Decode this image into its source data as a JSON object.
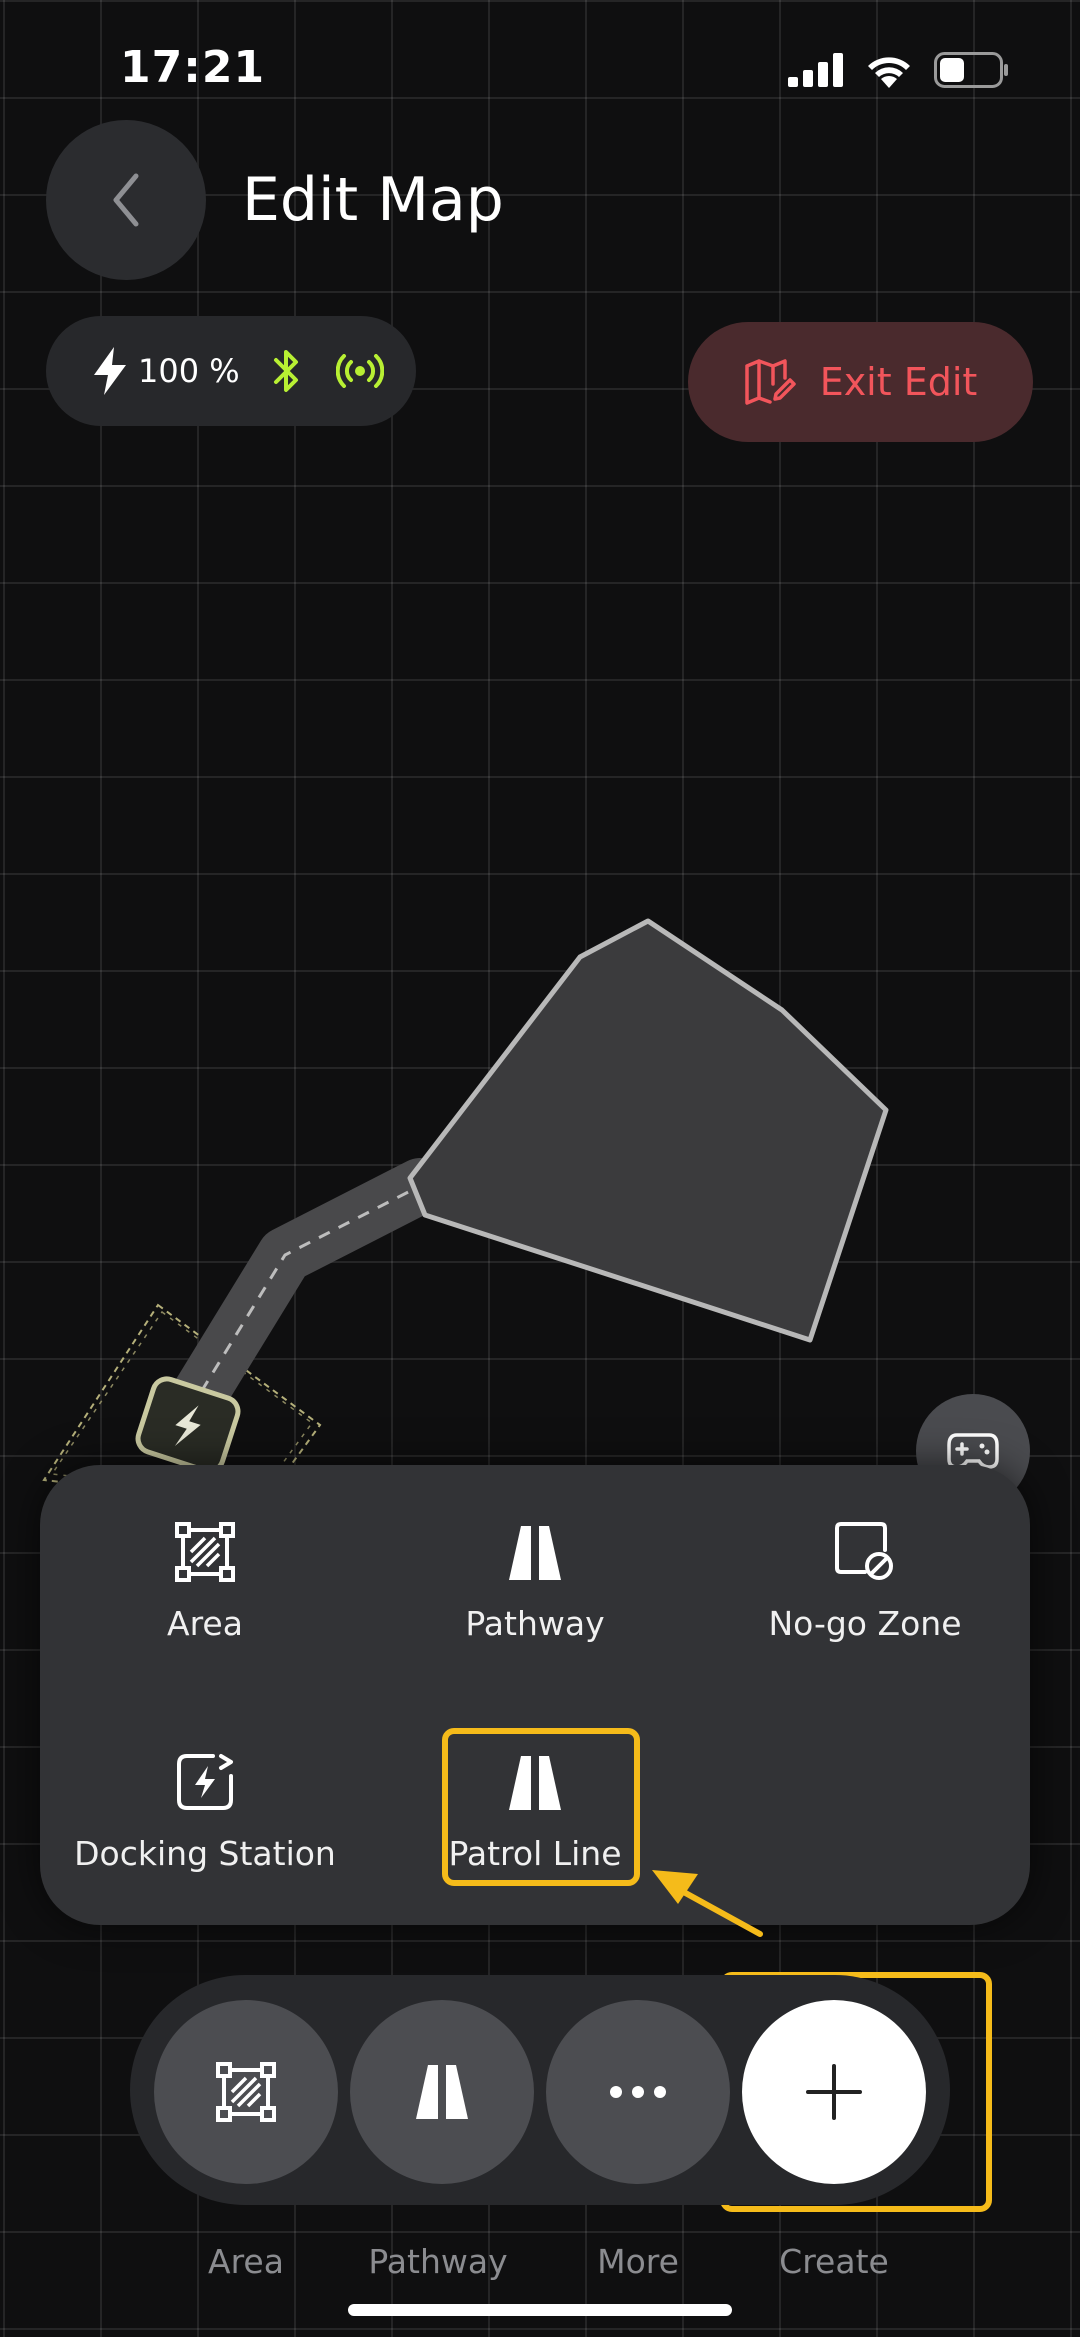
{
  "status_bar": {
    "time": "17:21"
  },
  "header": {
    "title": "Edit Map",
    "back_icon": "chevron-left-icon"
  },
  "robot_status": {
    "battery": "100 %",
    "bluetooth_icon": "bluetooth-icon",
    "signal_icon": "radio-signal-icon",
    "accent_color": "#b8f033"
  },
  "exit_edit": {
    "label": "Exit Edit",
    "icon": "map-edit-icon",
    "color": "#f2555b"
  },
  "create_menu": {
    "items": [
      {
        "label": "Area",
        "icon": "area-icon"
      },
      {
        "label": "Pathway",
        "icon": "pathway-icon"
      },
      {
        "label": "No-go Zone",
        "icon": "no-go-zone-icon"
      },
      {
        "label": "Docking Station",
        "icon": "docking-station-icon"
      },
      {
        "label": "Patrol Line",
        "icon": "patrol-line-icon"
      }
    ],
    "highlight_color": "#f5bb1a"
  },
  "toolbar": {
    "items": [
      {
        "label": "Area",
        "icon": "area-icon"
      },
      {
        "label": "Pathway",
        "icon": "pathway-icon"
      },
      {
        "label": "More",
        "icon": "more-icon"
      },
      {
        "label": "Create",
        "icon": "plus-icon"
      }
    ]
  }
}
